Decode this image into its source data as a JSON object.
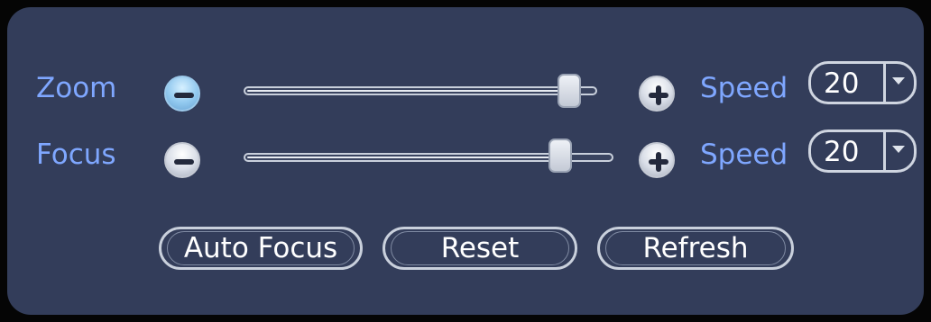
{
  "zoom": {
    "label": "Zoom",
    "speed_label": "Speed",
    "speed_value": "20",
    "slider_level": 0.95,
    "minus_icon": "minus-circle-icon",
    "plus_icon": "plus-circle-icon"
  },
  "focus": {
    "label": "Focus",
    "speed_label": "Speed",
    "speed_value": "20",
    "slider_level": 0.88,
    "minus_icon": "minus-circle-icon",
    "plus_icon": "plus-circle-icon"
  },
  "buttons": {
    "auto_focus": "Auto Focus",
    "reset": "Reset",
    "refresh": "Refresh"
  },
  "colors": {
    "panel": "#333d5a",
    "label": "#7fa7ff",
    "highlight": "#92c9ef"
  }
}
